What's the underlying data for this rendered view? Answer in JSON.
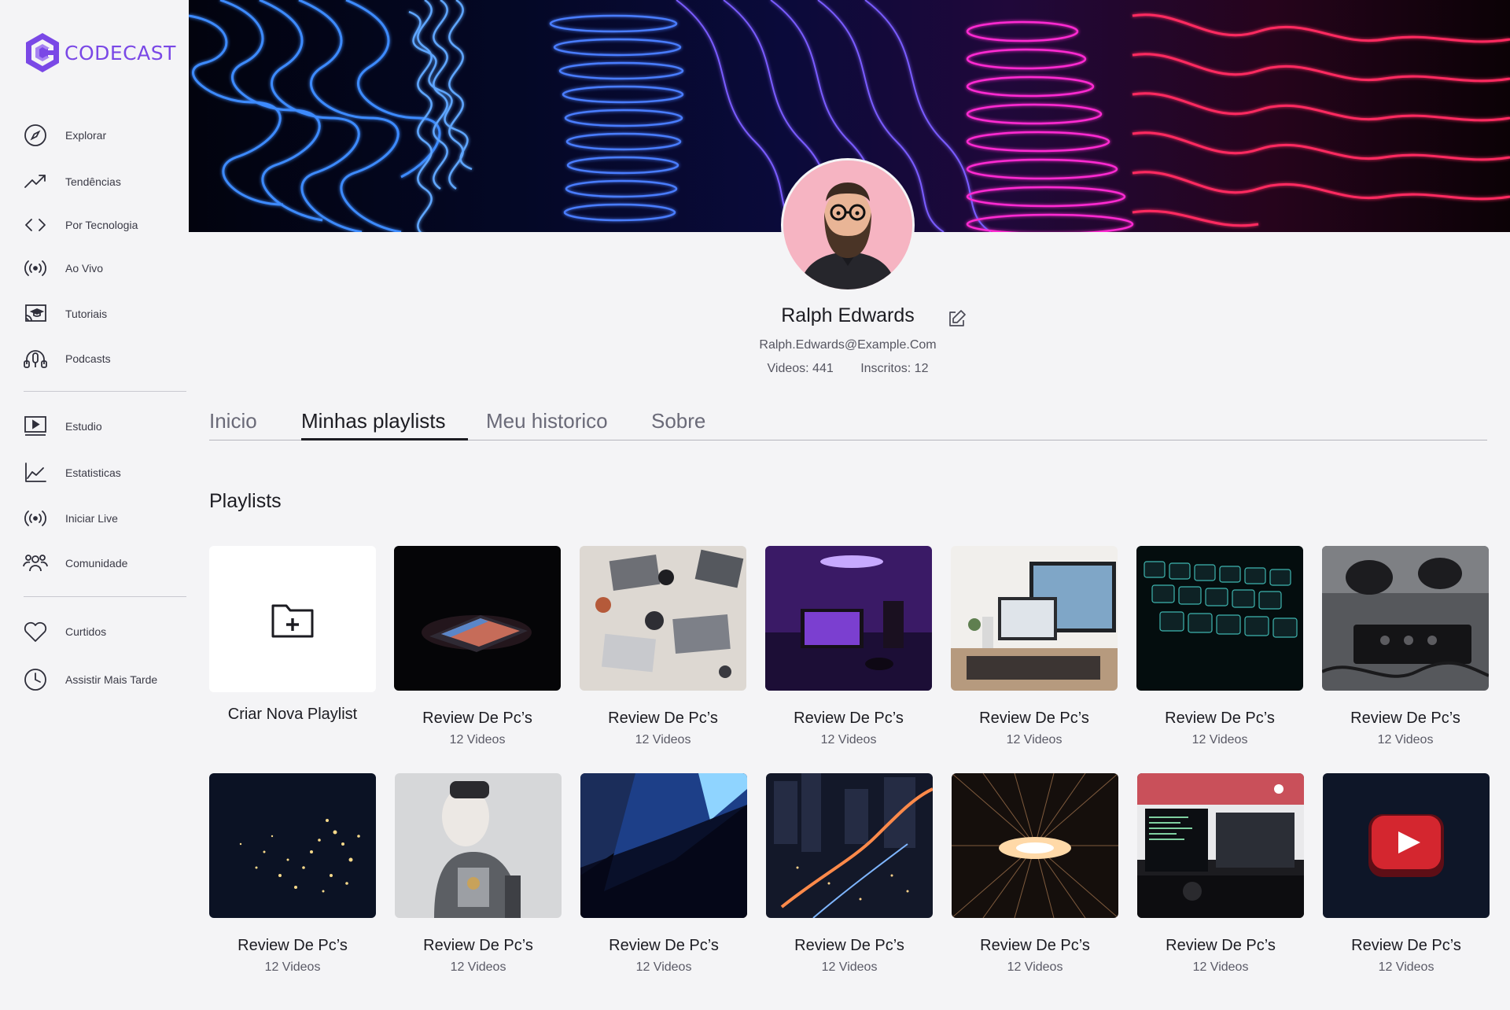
{
  "brand": {
    "name": "CODECAST",
    "color": "#7a48e6"
  },
  "sidebar": {
    "primary": [
      {
        "label": "Explorar",
        "icon": "compass-icon"
      },
      {
        "label": "Tendências",
        "icon": "trending-icon"
      },
      {
        "label": "Por Tecnologia",
        "icon": "code-icon"
      },
      {
        "label": "Ao Vivo",
        "icon": "broadcast-icon"
      },
      {
        "label": "Tutoriais",
        "icon": "cast-education-icon"
      },
      {
        "label": "Podcasts",
        "icon": "podcast-icon"
      }
    ],
    "studio": [
      {
        "label": "Estudio",
        "icon": "video-icon"
      },
      {
        "label": "Estatisticas",
        "icon": "chart-line-icon"
      },
      {
        "label": "Iniciar Live",
        "icon": "broadcast-icon"
      },
      {
        "label": "Comunidade",
        "icon": "community-icon"
      }
    ],
    "library": [
      {
        "label": "Curtidos",
        "icon": "heart-icon"
      },
      {
        "label": "Assistir Mais Tarde",
        "icon": "clock-icon"
      }
    ]
  },
  "profile": {
    "name": "Ralph Edwards",
    "email": "Ralph.Edwards@Example.Com",
    "videos": "Videos: 441",
    "subscribers": "Inscritos: 12"
  },
  "tabs": [
    {
      "label": "Inicio",
      "active": false
    },
    {
      "label": "Minhas playlists",
      "active": true
    },
    {
      "label": "Meu historico",
      "active": false
    },
    {
      "label": "Sobre",
      "active": false
    }
  ],
  "playlists": {
    "section_title": "Playlists",
    "create_label": "Criar Nova Playlist",
    "items": [
      {
        "title": "Review De Pc’s",
        "count": "12 Videos"
      },
      {
        "title": "Review De Pc’s",
        "count": "12 Videos"
      },
      {
        "title": "Review De Pc’s",
        "count": "12 Videos"
      },
      {
        "title": "Review De Pc’s",
        "count": "12 Videos"
      },
      {
        "title": "Review De Pc’s",
        "count": "12 Videos"
      },
      {
        "title": "Review De Pc’s",
        "count": "12 Videos"
      },
      {
        "title": "Review De Pc’s",
        "count": "12 Videos"
      },
      {
        "title": "Review De Pc’s",
        "count": "12 Videos"
      },
      {
        "title": "Review De Pc’s",
        "count": "12 Videos"
      },
      {
        "title": "Review De Pc’s",
        "count": "12 Videos"
      },
      {
        "title": "Review De Pc’s",
        "count": "12 Videos"
      },
      {
        "title": "Review De Pc’s",
        "count": "12 Videos"
      },
      {
        "title": "Review De Pc’s",
        "count": "12 Videos"
      }
    ]
  }
}
